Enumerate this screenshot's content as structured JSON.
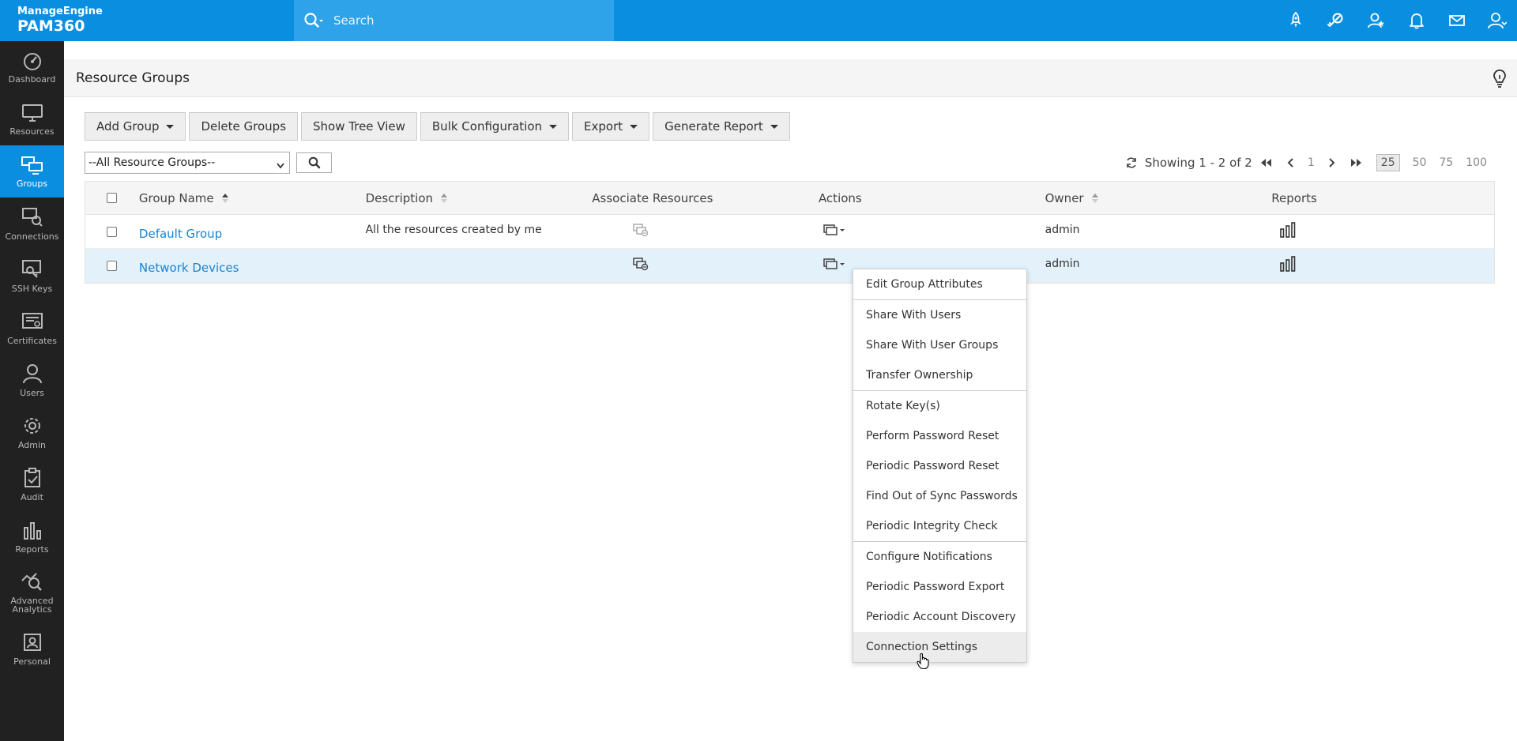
{
  "brand": {
    "top": "ManageEngine",
    "product": "PAM360"
  },
  "search": {
    "placeholder": "Search"
  },
  "top_icons": [
    "rocket-icon",
    "link-key-icon",
    "user-star-icon",
    "bell-icon",
    "mail-icon",
    "user-profile-icon"
  ],
  "sidebar": {
    "items": [
      {
        "label": "Dashboard",
        "icon": "dashboard-icon"
      },
      {
        "label": "Resources",
        "icon": "monitor-icon"
      },
      {
        "label": "Groups",
        "icon": "groups-icon",
        "active": true
      },
      {
        "label": "Connections",
        "icon": "connections-icon"
      },
      {
        "label": "SSH Keys",
        "icon": "ssh-key-icon"
      },
      {
        "label": "Certificates",
        "icon": "certificate-icon"
      },
      {
        "label": "Users",
        "icon": "user-icon"
      },
      {
        "label": "Admin",
        "icon": "gear-icon"
      },
      {
        "label": "Audit",
        "icon": "audit-icon"
      },
      {
        "label": "Reports",
        "icon": "bar-chart-icon"
      },
      {
        "label": "Advanced Analytics",
        "icon": "analytics-icon"
      },
      {
        "label": "Personal",
        "icon": "personal-icon"
      }
    ]
  },
  "page": {
    "title": "Resource Groups"
  },
  "toolbar": {
    "add_group": "Add Group",
    "delete_groups": "Delete Groups",
    "show_tree_view": "Show Tree View",
    "bulk_configuration": "Bulk Configuration",
    "export": "Export",
    "generate_report": "Generate Report"
  },
  "filter": {
    "selected": "--All Resource Groups--"
  },
  "pager": {
    "showing": "Showing 1 - 2 of 2",
    "page": "1",
    "sizes": [
      "25",
      "50",
      "75",
      "100"
    ],
    "selected_size": "25"
  },
  "table": {
    "headers": {
      "group_name": "Group Name",
      "description": "Description",
      "associate_resources": "Associate Resources",
      "actions": "Actions",
      "owner": "Owner",
      "reports": "Reports"
    },
    "rows": [
      {
        "group_name": "Default Group",
        "description": "All the resources created by me",
        "owner": "admin"
      },
      {
        "group_name": "Network Devices",
        "description": "",
        "owner": "admin"
      }
    ]
  },
  "actions_menu": {
    "groups": [
      [
        "Edit Group Attributes"
      ],
      [
        "Share With Users",
        "Share With User Groups",
        "Transfer Ownership"
      ],
      [
        "Rotate Key(s)",
        "Perform Password Reset",
        "Periodic Password Reset",
        "Find Out of Sync Passwords",
        "Periodic Integrity Check"
      ],
      [
        "Configure Notifications",
        "Periodic Password Export",
        "Periodic Account Discovery",
        "Connection Settings"
      ]
    ],
    "hovered": "Connection Settings"
  },
  "colors": {
    "topbar": "#0a8fe0",
    "sidebar": "#212121",
    "active_nav": "#0a8fe0",
    "link": "#1a82d0",
    "row_highlight": "#e3f1fb"
  }
}
